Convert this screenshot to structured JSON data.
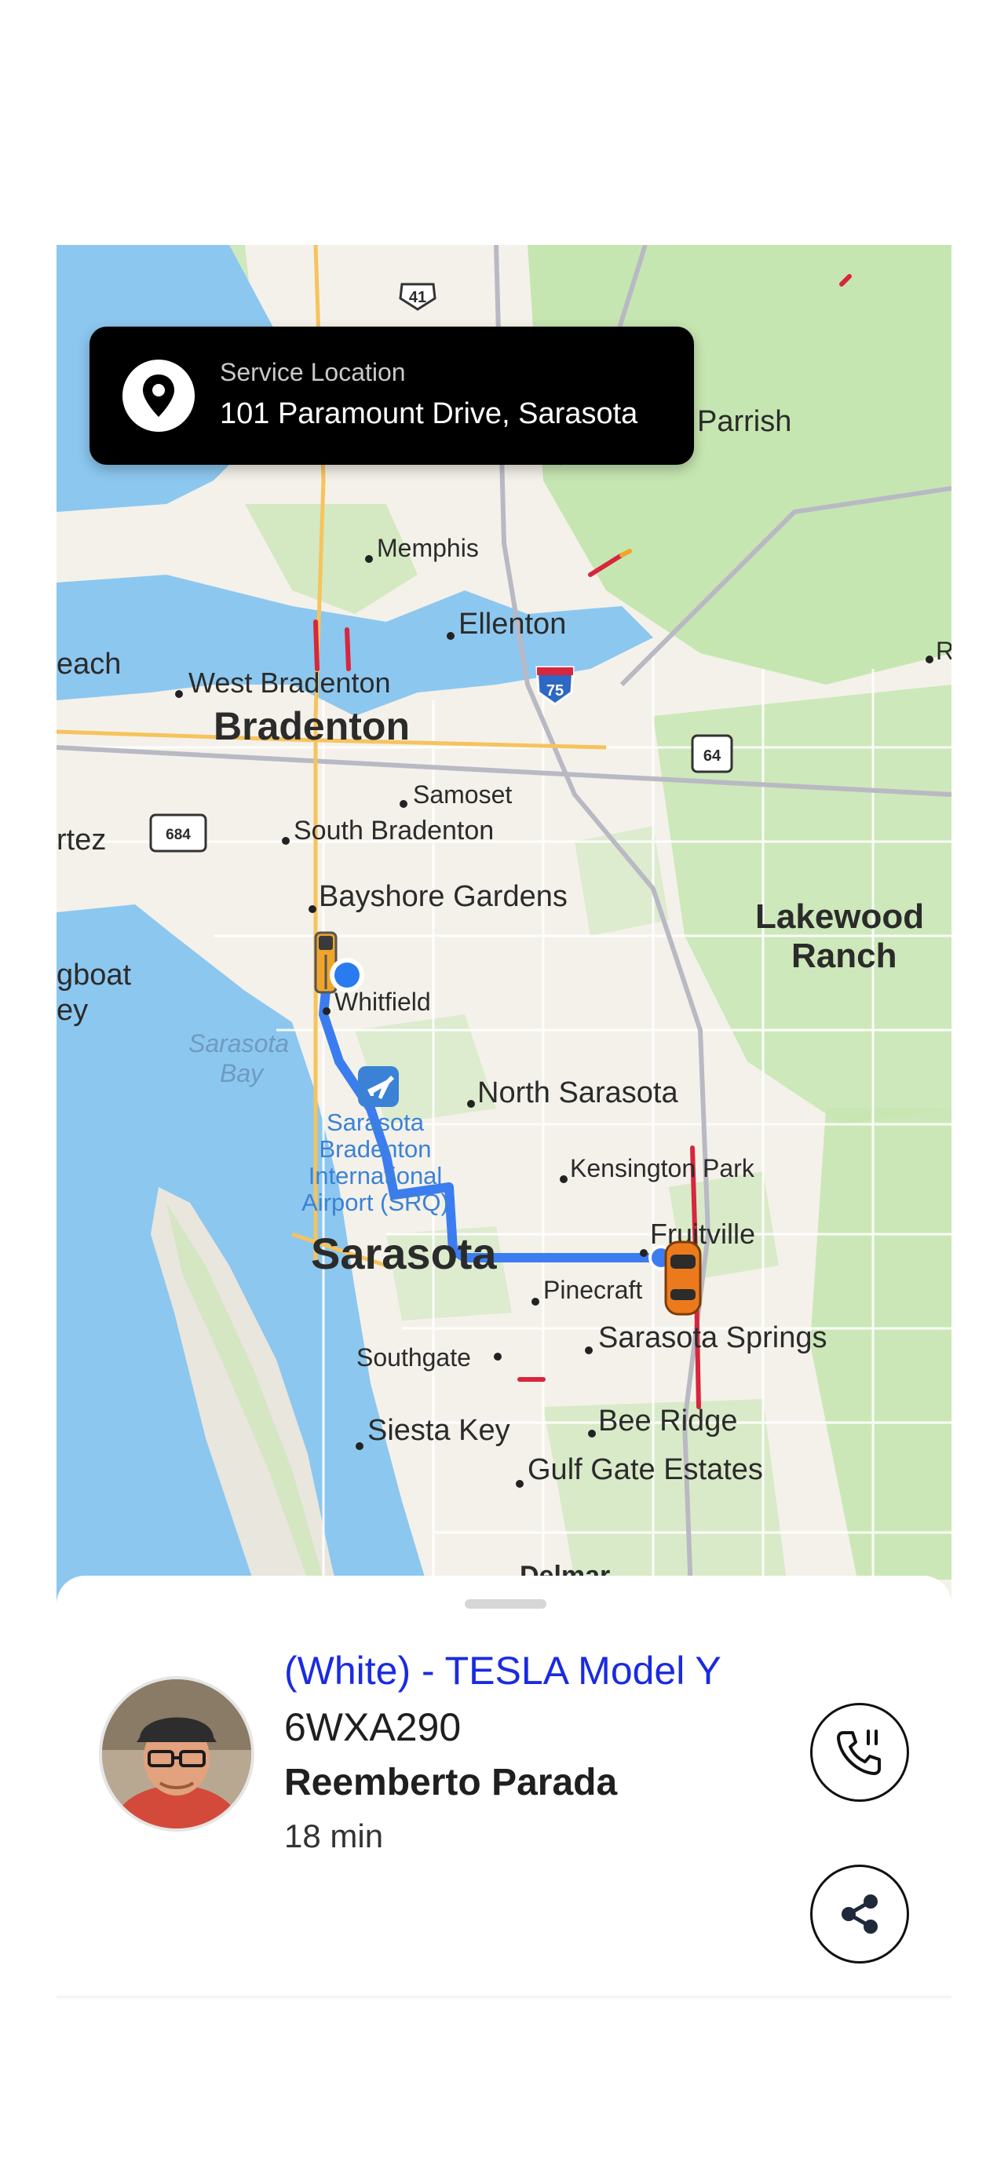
{
  "service_location": {
    "label": "Service Location",
    "address": "101 Paramount Drive, Sarasota"
  },
  "map": {
    "places": {
      "parrish": "Parrish",
      "memphis": "Memphis",
      "ellenton": "Ellenton",
      "each": "each",
      "west_bradenton": "West Bradenton",
      "bradenton": "Bradenton",
      "samoset": "Samoset",
      "rtez": "rtez",
      "south_bradenton": "South Bradenton",
      "bayshore_gardens": "Bayshore Gardens",
      "lakewood": "Lakewood",
      "ranch": "Ranch",
      "gboat": "gboat",
      "ey": "ey",
      "whitfield": "Whitfield",
      "sarasota_bay_1": "Sarasota",
      "sarasota_bay_2": "Bay",
      "north_sarasota": "North Sarasota",
      "airport_1": "Sarasota",
      "airport_2": "Bradenton",
      "airport_3": "International",
      "airport_4": "Airport (SRQ)",
      "kensington_park": "Kensington Park",
      "fruitville": "Fruitville",
      "sarasota": "Sarasota",
      "pinecraft": "Pinecraft",
      "sarasota_springs": "Sarasota Springs",
      "southgate": "Southgate",
      "siesta_key": "Siesta Key",
      "bee_ridge": "Bee Ridge",
      "gulf_gate_estates": "Gulf Gate Estates",
      "delmar": "Delmar",
      "r_edge": "R"
    },
    "shields": {
      "us41": "41",
      "i75": "75",
      "sr64": "64",
      "sr684": "684"
    },
    "colors": {
      "water": "#8cc7ef",
      "land": "#f4f1ea",
      "park": "#c6e6b1",
      "route": "#3b7df0",
      "traffic_red": "#d7263d",
      "traffic_orange": "#f0a52a"
    }
  },
  "driver": {
    "vehicle": "(White) - TESLA Model Y",
    "plate": "6WXA290",
    "name": "Reemberto Parada",
    "eta": "18 min"
  },
  "actions": {
    "call_icon": "phone-call-icon",
    "share_icon": "share-icon"
  }
}
